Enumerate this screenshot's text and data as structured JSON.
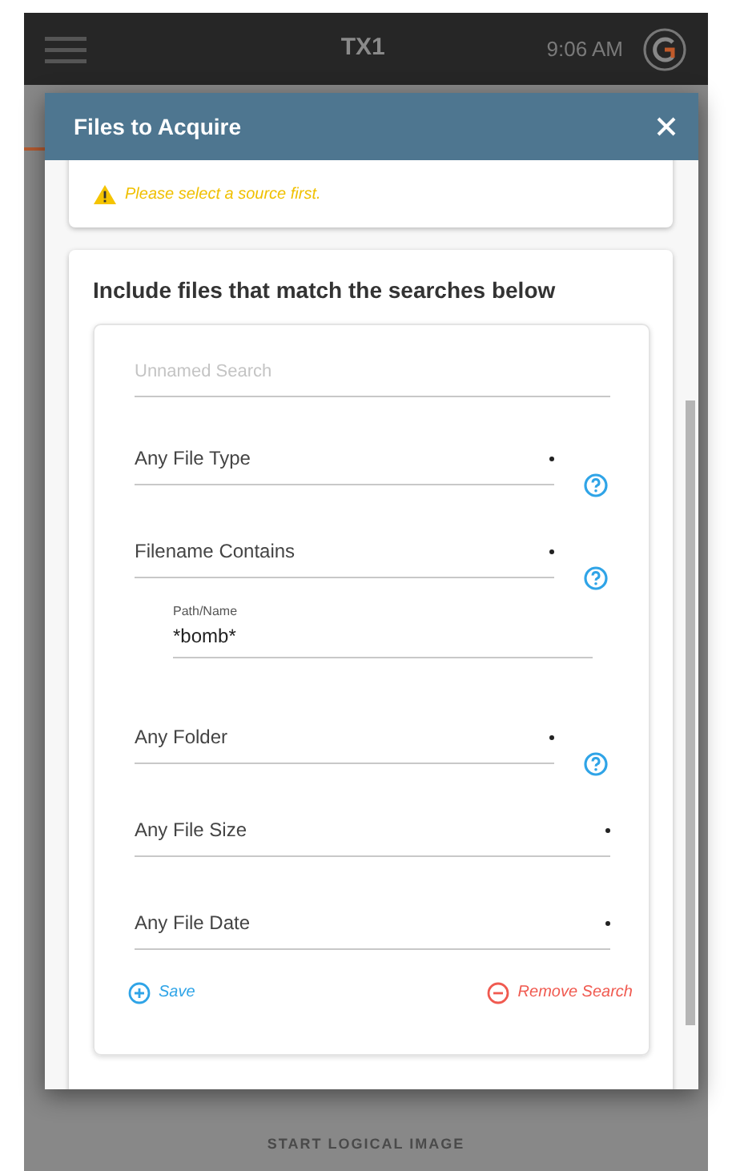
{
  "top_bar": {
    "title": "TX1",
    "time": "9:06 AM"
  },
  "dialog": {
    "title": "Files to Acquire",
    "warning": "Please select a source first.",
    "section_title": "Include files that match the searches below",
    "search": {
      "name_placeholder": "Unnamed Search",
      "fields": [
        {
          "kind": "select",
          "value": "Any File Type",
          "help": true
        },
        {
          "kind": "select",
          "value": "Filename Contains",
          "help": true
        },
        {
          "kind": "text",
          "label": "Path/Name",
          "value": "*bomb*"
        },
        {
          "kind": "select",
          "value": "Any Folder",
          "help": true
        },
        {
          "kind": "select",
          "value": "Any File Size",
          "help": false
        },
        {
          "kind": "select",
          "value": "Any File Date",
          "help": false
        }
      ],
      "save": "Save",
      "remove": "Remove Search"
    }
  },
  "footer_button": "START LOGICAL IMAGE"
}
